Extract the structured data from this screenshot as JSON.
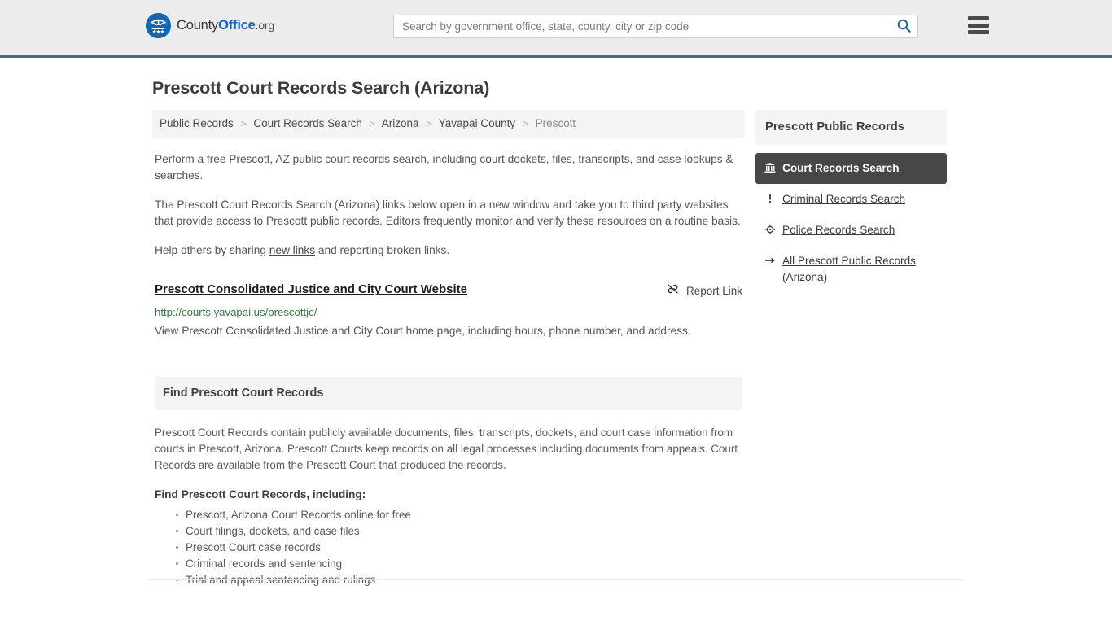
{
  "header": {
    "brand": {
      "part1": "County",
      "part2": "Office",
      "part3": ".org",
      "logo_icon": "eagle-seal-icon"
    },
    "search": {
      "placeholder": "Search by government office, state, county, city or zip code",
      "value": "",
      "icon": "search-icon"
    },
    "menu_icon": "hamburger-menu-icon",
    "accent_color": "#31709c",
    "background_color": "#ececec"
  },
  "page": {
    "title": "Prescott Court Records Search (Arizona)"
  },
  "breadcrumb": {
    "items": [
      {
        "label": "Public Records",
        "current": false
      },
      {
        "label": "Court Records Search",
        "current": false
      },
      {
        "label": "Arizona",
        "current": false
      },
      {
        "label": "Yavapai County",
        "current": false
      },
      {
        "label": "Prescott",
        "current": true
      }
    ],
    "separator": ">"
  },
  "intro": {
    "paragraph1": "Perform a free Prescott, AZ public court records search, including court dockets, files, transcripts, and case lookups & searches.",
    "paragraph2": "The Prescott Court Records Search (Arizona) links below open in a new window and take you to third party websites that provide access to Prescott public records. Editors frequently monitor and verify these resources on a routine basis.",
    "paragraph3_pre": "Help others by sharing ",
    "paragraph3_link": "new links",
    "paragraph3_post": " and reporting broken links."
  },
  "result": {
    "title": "Prescott Consolidated Justice and City Court Website",
    "report_label": "Report Link",
    "report_icon": "broken-link-icon",
    "url": "http://courts.yavapai.us/prescottjc/",
    "url_color": "#3a7344",
    "description": "View Prescott Consolidated Justice and City Court home page, including hours, phone number, and address."
  },
  "find_section": {
    "heading": "Find Prescott Court Records",
    "paragraph": "Prescott Court Records contain publicly available documents, files, transcripts, dockets, and court case information from courts in Prescott, Arizona. Prescott Courts keep records on all legal processes including documents from appeals. Court Records are available from the Prescott Court that produced the records.",
    "subheading": "Find Prescott Court Records, including:",
    "bullets": [
      "Prescott, Arizona Court Records online for free",
      "Court filings, dockets, and case files",
      "Prescott Court case records",
      "Criminal records and sentencing",
      "Trial and appeal sentencing and rulings"
    ]
  },
  "sidebar": {
    "heading": "Prescott Public Records",
    "active_background": "#474747",
    "items": [
      {
        "label": "Court Records Search",
        "icon": "courthouse-icon",
        "active": true
      },
      {
        "label": "Criminal Records Search",
        "icon": "exclamation-icon",
        "active": false
      },
      {
        "label": "Police Records Search",
        "icon": "police-badge-icon",
        "active": false
      },
      {
        "label": "All Prescott Public Records (Arizona)",
        "icon": "arrow-right-icon",
        "active": false
      }
    ]
  }
}
